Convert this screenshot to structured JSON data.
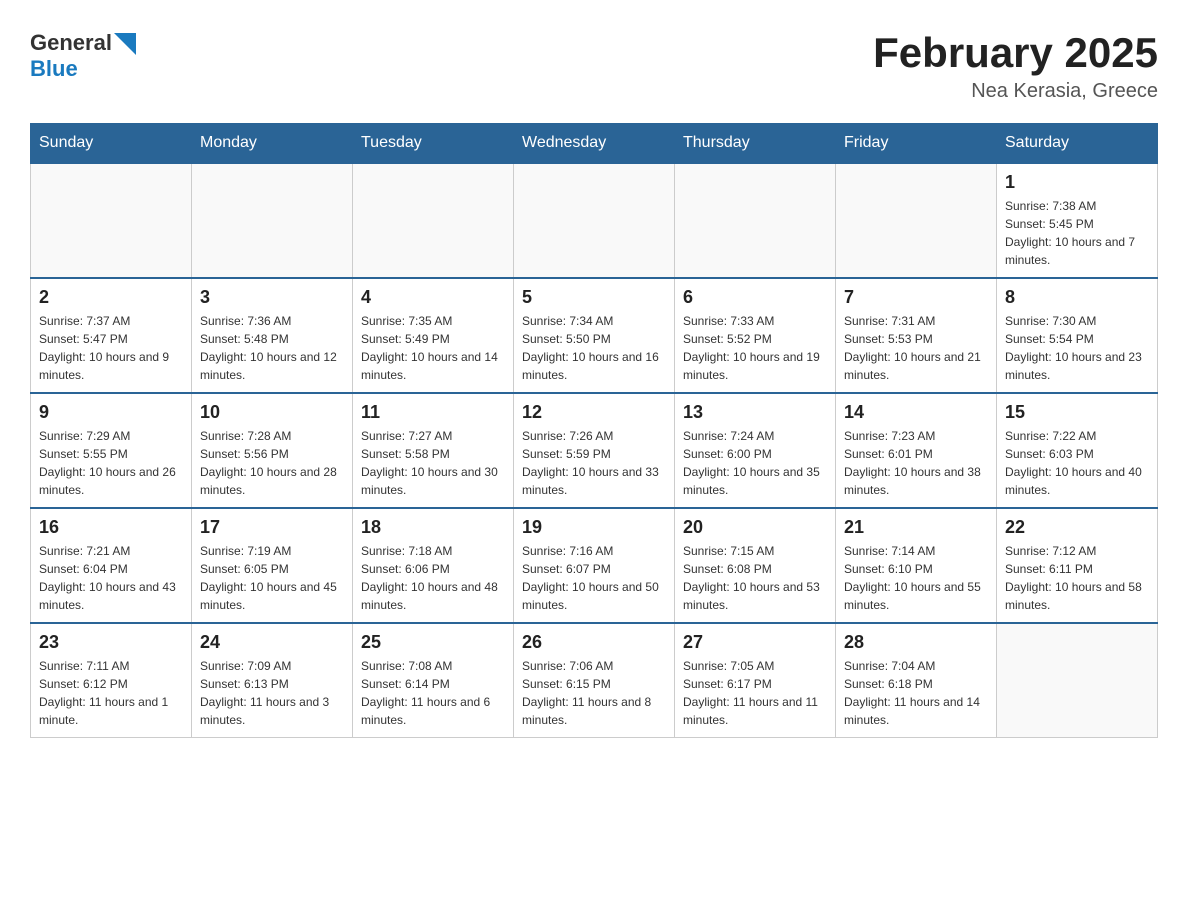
{
  "header": {
    "logo_general": "General",
    "logo_blue": "Blue",
    "month_title": "February 2025",
    "location": "Nea Kerasia, Greece"
  },
  "days_of_week": [
    "Sunday",
    "Monday",
    "Tuesday",
    "Wednesday",
    "Thursday",
    "Friday",
    "Saturday"
  ],
  "weeks": [
    [
      {
        "day": "",
        "info": ""
      },
      {
        "day": "",
        "info": ""
      },
      {
        "day": "",
        "info": ""
      },
      {
        "day": "",
        "info": ""
      },
      {
        "day": "",
        "info": ""
      },
      {
        "day": "",
        "info": ""
      },
      {
        "day": "1",
        "info": "Sunrise: 7:38 AM\nSunset: 5:45 PM\nDaylight: 10 hours and 7 minutes."
      }
    ],
    [
      {
        "day": "2",
        "info": "Sunrise: 7:37 AM\nSunset: 5:47 PM\nDaylight: 10 hours and 9 minutes."
      },
      {
        "day": "3",
        "info": "Sunrise: 7:36 AM\nSunset: 5:48 PM\nDaylight: 10 hours and 12 minutes."
      },
      {
        "day": "4",
        "info": "Sunrise: 7:35 AM\nSunset: 5:49 PM\nDaylight: 10 hours and 14 minutes."
      },
      {
        "day": "5",
        "info": "Sunrise: 7:34 AM\nSunset: 5:50 PM\nDaylight: 10 hours and 16 minutes."
      },
      {
        "day": "6",
        "info": "Sunrise: 7:33 AM\nSunset: 5:52 PM\nDaylight: 10 hours and 19 minutes."
      },
      {
        "day": "7",
        "info": "Sunrise: 7:31 AM\nSunset: 5:53 PM\nDaylight: 10 hours and 21 minutes."
      },
      {
        "day": "8",
        "info": "Sunrise: 7:30 AM\nSunset: 5:54 PM\nDaylight: 10 hours and 23 minutes."
      }
    ],
    [
      {
        "day": "9",
        "info": "Sunrise: 7:29 AM\nSunset: 5:55 PM\nDaylight: 10 hours and 26 minutes."
      },
      {
        "day": "10",
        "info": "Sunrise: 7:28 AM\nSunset: 5:56 PM\nDaylight: 10 hours and 28 minutes."
      },
      {
        "day": "11",
        "info": "Sunrise: 7:27 AM\nSunset: 5:58 PM\nDaylight: 10 hours and 30 minutes."
      },
      {
        "day": "12",
        "info": "Sunrise: 7:26 AM\nSunset: 5:59 PM\nDaylight: 10 hours and 33 minutes."
      },
      {
        "day": "13",
        "info": "Sunrise: 7:24 AM\nSunset: 6:00 PM\nDaylight: 10 hours and 35 minutes."
      },
      {
        "day": "14",
        "info": "Sunrise: 7:23 AM\nSunset: 6:01 PM\nDaylight: 10 hours and 38 minutes."
      },
      {
        "day": "15",
        "info": "Sunrise: 7:22 AM\nSunset: 6:03 PM\nDaylight: 10 hours and 40 minutes."
      }
    ],
    [
      {
        "day": "16",
        "info": "Sunrise: 7:21 AM\nSunset: 6:04 PM\nDaylight: 10 hours and 43 minutes."
      },
      {
        "day": "17",
        "info": "Sunrise: 7:19 AM\nSunset: 6:05 PM\nDaylight: 10 hours and 45 minutes."
      },
      {
        "day": "18",
        "info": "Sunrise: 7:18 AM\nSunset: 6:06 PM\nDaylight: 10 hours and 48 minutes."
      },
      {
        "day": "19",
        "info": "Sunrise: 7:16 AM\nSunset: 6:07 PM\nDaylight: 10 hours and 50 minutes."
      },
      {
        "day": "20",
        "info": "Sunrise: 7:15 AM\nSunset: 6:08 PM\nDaylight: 10 hours and 53 minutes."
      },
      {
        "day": "21",
        "info": "Sunrise: 7:14 AM\nSunset: 6:10 PM\nDaylight: 10 hours and 55 minutes."
      },
      {
        "day": "22",
        "info": "Sunrise: 7:12 AM\nSunset: 6:11 PM\nDaylight: 10 hours and 58 minutes."
      }
    ],
    [
      {
        "day": "23",
        "info": "Sunrise: 7:11 AM\nSunset: 6:12 PM\nDaylight: 11 hours and 1 minute."
      },
      {
        "day": "24",
        "info": "Sunrise: 7:09 AM\nSunset: 6:13 PM\nDaylight: 11 hours and 3 minutes."
      },
      {
        "day": "25",
        "info": "Sunrise: 7:08 AM\nSunset: 6:14 PM\nDaylight: 11 hours and 6 minutes."
      },
      {
        "day": "26",
        "info": "Sunrise: 7:06 AM\nSunset: 6:15 PM\nDaylight: 11 hours and 8 minutes."
      },
      {
        "day": "27",
        "info": "Sunrise: 7:05 AM\nSunset: 6:17 PM\nDaylight: 11 hours and 11 minutes."
      },
      {
        "day": "28",
        "info": "Sunrise: 7:04 AM\nSunset: 6:18 PM\nDaylight: 11 hours and 14 minutes."
      },
      {
        "day": "",
        "info": ""
      }
    ]
  ]
}
